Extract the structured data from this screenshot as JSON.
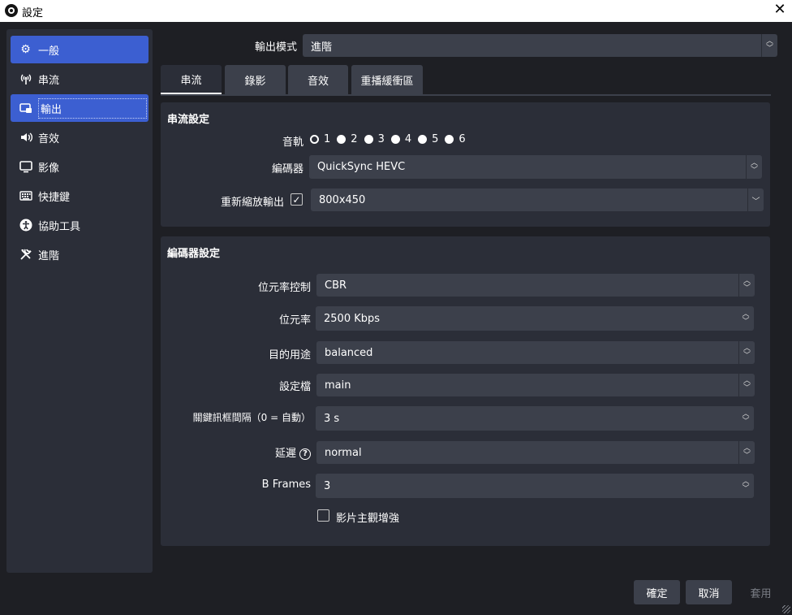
{
  "window": {
    "title": "設定"
  },
  "sidebar": {
    "items": [
      {
        "label": "一般",
        "icon": "gear-icon"
      },
      {
        "label": "串流",
        "icon": "antenna-icon"
      },
      {
        "label": "輸出",
        "icon": "output-icon"
      },
      {
        "label": "音效",
        "icon": "speaker-icon"
      },
      {
        "label": "影像",
        "icon": "monitor-icon"
      },
      {
        "label": "快捷鍵",
        "icon": "keyboard-icon"
      },
      {
        "label": "協助工具",
        "icon": "accessibility-icon"
      },
      {
        "label": "進階",
        "icon": "tools-icon"
      }
    ]
  },
  "output_mode": {
    "label": "輸出模式",
    "value": "進階"
  },
  "tabs": [
    {
      "label": "串流"
    },
    {
      "label": "錄影"
    },
    {
      "label": "音效"
    },
    {
      "label": "重播緩衝區"
    }
  ],
  "stream_settings": {
    "title": "串流設定",
    "audio_track_label": "音軌",
    "tracks": [
      "1",
      "2",
      "3",
      "4",
      "5",
      "6"
    ],
    "selected_track": "1",
    "encoder_label": "編碼器",
    "encoder_value": "QuickSync HEVC",
    "rescale_label": "重新縮放輸出",
    "rescale_checked": true,
    "rescale_value": "800x450"
  },
  "encoder_settings": {
    "title": "編碼器設定",
    "rate_control_label": "位元率控制",
    "rate_control_value": "CBR",
    "bitrate_label": "位元率",
    "bitrate_value": "2500 Kbps",
    "target_usage_label": "目的用途",
    "target_usage_value": "balanced",
    "profile_label": "設定檔",
    "profile_value": "main",
    "keyframe_label": "關鍵訊框間隔（0 = 自動）",
    "keyframe_value": "3 s",
    "latency_label": "延遲",
    "latency_value": "normal",
    "bframes_label": "B Frames",
    "bframes_value": "3",
    "subjective_label": "影片主觀增強",
    "subjective_checked": false
  },
  "buttons": {
    "ok": "確定",
    "cancel": "取消",
    "apply": "套用"
  },
  "colors": {
    "accent": "#3c5fd1",
    "background": "#1e1f24",
    "panel": "#2b2e38",
    "control": "#3c404b"
  }
}
